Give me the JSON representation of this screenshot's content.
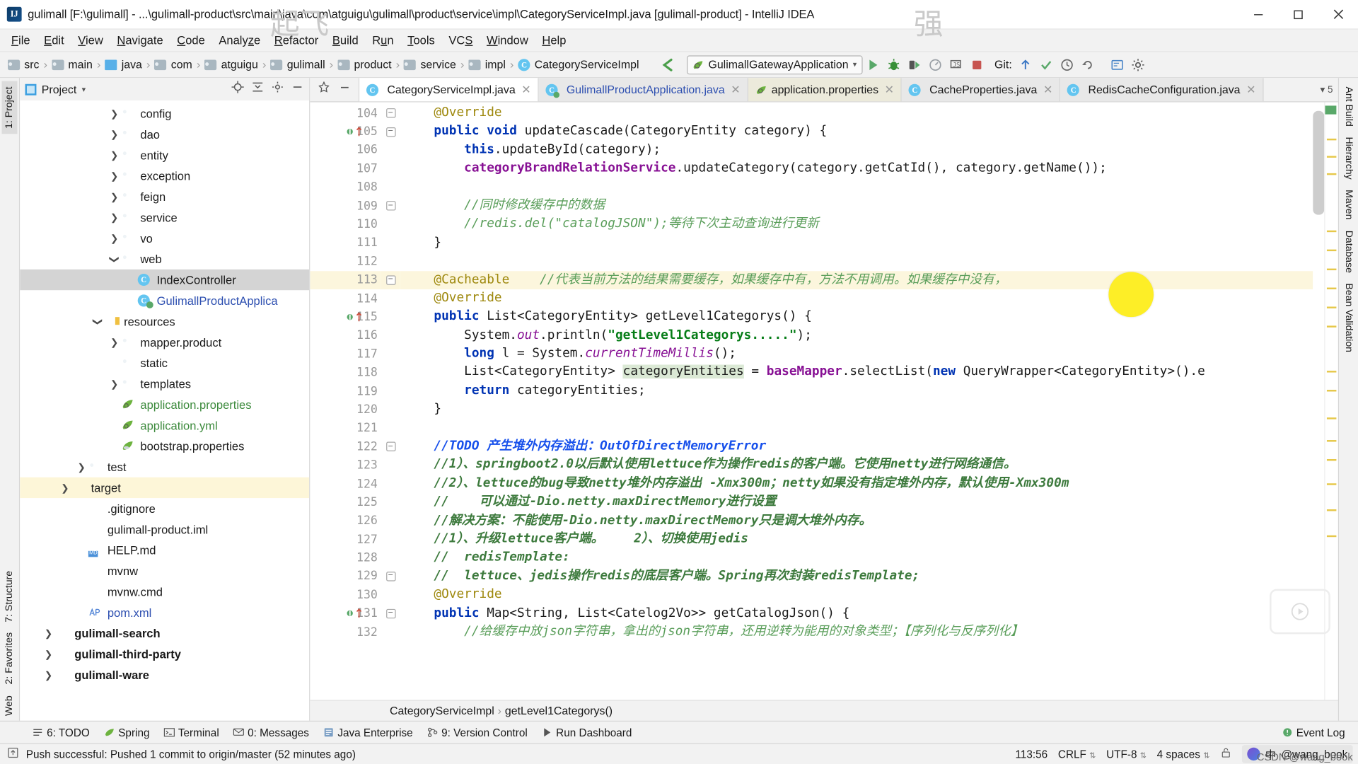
{
  "window": {
    "title": "gulimall [F:\\gulimall] - ...\\gulimall-product\\src\\main\\java\\com\\atguigu\\gulimall\\product\\service\\impl\\CategoryServiceImpl.java [gulimall-product] - IntelliJ IDEA",
    "app_icon": "IJ",
    "minimize": "—",
    "maximize": "❐",
    "close": "✕"
  },
  "menubar": {
    "items": [
      {
        "label": "File",
        "mnemonic": "F"
      },
      {
        "label": "Edit",
        "mnemonic": "E"
      },
      {
        "label": "View",
        "mnemonic": "V"
      },
      {
        "label": "Navigate",
        "mnemonic": "N"
      },
      {
        "label": "Code",
        "mnemonic": "C"
      },
      {
        "label": "Analyze",
        "mnemonic": "z"
      },
      {
        "label": "Refactor",
        "mnemonic": "R"
      },
      {
        "label": "Build",
        "mnemonic": "B"
      },
      {
        "label": "Run",
        "mnemonic": "u"
      },
      {
        "label": "Tools",
        "mnemonic": "T"
      },
      {
        "label": "VCS",
        "mnemonic": "S"
      },
      {
        "label": "Window",
        "mnemonic": "W"
      },
      {
        "label": "Help",
        "mnemonic": "H"
      }
    ]
  },
  "navbar": {
    "breadcrumbs": [
      {
        "label": "src",
        "icon": "folder-icon"
      },
      {
        "label": "main",
        "icon": "folder-icon"
      },
      {
        "label": "java",
        "icon": "source-folder-icon"
      },
      {
        "label": "com",
        "icon": "package-icon"
      },
      {
        "label": "atguigu",
        "icon": "package-icon"
      },
      {
        "label": "gulimall",
        "icon": "package-icon"
      },
      {
        "label": "product",
        "icon": "package-icon"
      },
      {
        "label": "service",
        "icon": "package-icon"
      },
      {
        "label": "impl",
        "icon": "package-icon"
      },
      {
        "label": "CategoryServiceImpl",
        "icon": "java-class-icon"
      }
    ],
    "run_config": "GulimallGatewayApplication",
    "git_label": "Git:",
    "toolbar_icons": [
      "run-icon",
      "debug-icon",
      "run-with-coverage-icon",
      "profile-icon",
      "attach-debugger-icon",
      "stop-icon"
    ],
    "git_icons": [
      "update-project-icon",
      "commit-icon",
      "history-icon",
      "rollback-icon"
    ],
    "right_icons": [
      "search-everywhere-icon",
      "settings-icon"
    ]
  },
  "project_panel": {
    "title": "Project",
    "tools": [
      "locate-icon",
      "collapse-all-icon",
      "settings-icon",
      "hide-icon"
    ],
    "tree": [
      {
        "label": "config",
        "indent": 5,
        "arrow": "right",
        "icon": "folder-icon"
      },
      {
        "label": "dao",
        "indent": 5,
        "arrow": "right",
        "icon": "folder-icon"
      },
      {
        "label": "entity",
        "indent": 5,
        "arrow": "right",
        "icon": "folder-icon"
      },
      {
        "label": "exception",
        "indent": 5,
        "arrow": "right",
        "icon": "folder-icon"
      },
      {
        "label": "feign",
        "indent": 5,
        "arrow": "right",
        "icon": "folder-icon"
      },
      {
        "label": "service",
        "indent": 5,
        "arrow": "right",
        "icon": "folder-icon"
      },
      {
        "label": "vo",
        "indent": 5,
        "arrow": "right",
        "icon": "folder-icon"
      },
      {
        "label": "web",
        "indent": 5,
        "arrow": "down",
        "icon": "folder-icon"
      },
      {
        "label": "IndexController",
        "indent": 6,
        "arrow": "none",
        "icon": "java-class-icon",
        "state": "selected"
      },
      {
        "label": "GulimallProductApplica",
        "indent": 6,
        "arrow": "none",
        "icon": "java-runnable-class-icon",
        "color": "blue"
      },
      {
        "label": "resources",
        "indent": 4,
        "arrow": "down",
        "icon": "resources-folder-icon"
      },
      {
        "label": "mapper.product",
        "indent": 5,
        "arrow": "right",
        "icon": "folder-icon"
      },
      {
        "label": "static",
        "indent": 5,
        "arrow": "none",
        "icon": "folder-icon"
      },
      {
        "label": "templates",
        "indent": 5,
        "arrow": "right",
        "icon": "folder-icon"
      },
      {
        "label": "application.properties",
        "indent": 5,
        "arrow": "none",
        "icon": "spring-properties-icon",
        "color": "green"
      },
      {
        "label": "application.yml",
        "indent": 5,
        "arrow": "none",
        "icon": "spring-yml-icon",
        "color": "green"
      },
      {
        "label": "bootstrap.properties",
        "indent": 5,
        "arrow": "none",
        "icon": "spring-cloud-properties-icon"
      },
      {
        "label": "test",
        "indent": 3,
        "arrow": "right",
        "icon": "folder-icon"
      },
      {
        "label": "target",
        "indent": 2,
        "arrow": "right",
        "icon": "target-folder-icon",
        "state": "highlighted"
      },
      {
        "label": ".gitignore",
        "indent": 3,
        "arrow": "none",
        "icon": "text-file-icon"
      },
      {
        "label": "gulimall-product.iml",
        "indent": 3,
        "arrow": "none",
        "icon": "iml-file-icon"
      },
      {
        "label": "HELP.md",
        "indent": 3,
        "arrow": "none",
        "icon": "markdown-file-icon"
      },
      {
        "label": "mvnw",
        "indent": 3,
        "arrow": "none",
        "icon": "text-file-icon"
      },
      {
        "label": "mvnw.cmd",
        "indent": 3,
        "arrow": "none",
        "icon": "text-file-icon"
      },
      {
        "label": "pom.xml",
        "indent": 3,
        "arrow": "none",
        "icon": "maven-pom-icon",
        "color": "blue"
      },
      {
        "label": "gulimall-search",
        "indent": 1,
        "arrow": "right",
        "icon": "module-folder-icon",
        "bold": true
      },
      {
        "label": "gulimall-third-party",
        "indent": 1,
        "arrow": "right",
        "icon": "module-folder-icon",
        "bold": true
      },
      {
        "label": "gulimall-ware",
        "indent": 1,
        "arrow": "right",
        "icon": "module-folder-icon",
        "bold": true
      }
    ]
  },
  "left_rail": [
    {
      "label": "1: Project",
      "state": "selected"
    },
    {
      "label": "7: Structure"
    },
    {
      "label": "2: Favorites"
    },
    {
      "label": "Web"
    }
  ],
  "right_rail": [
    {
      "label": "Ant Build"
    },
    {
      "label": "Hierarchy"
    },
    {
      "label": "Maven"
    },
    {
      "label": "Database"
    },
    {
      "label": "Bean Validation"
    }
  ],
  "editor": {
    "tabs": [
      {
        "label": "CategoryServiceImpl.java",
        "icon": "java-class-icon",
        "active": true
      },
      {
        "label": "GulimallProductApplication.java",
        "icon": "java-runnable-class-icon",
        "color": "blue"
      },
      {
        "label": "application.properties",
        "icon": "spring-properties-icon"
      },
      {
        "label": "CacheProperties.java",
        "icon": "java-class-icon"
      },
      {
        "label": "RedisCacheConfiguration.java",
        "icon": "java-class-icon"
      }
    ],
    "tab_overflow": "5",
    "first_line": 104,
    "highlight_line": 113,
    "breadcrumb": [
      "CategoryServiceImpl",
      "getLevel1Categorys()"
    ],
    "lines": [
      {
        "n": 104,
        "fold": "minus",
        "html": "    <span class=\"ann\">@Override</span>"
      },
      {
        "n": 105,
        "fold": "minus",
        "mark": "override-impl",
        "html": "    <span class=\"kw\">public</span> <span class=\"kw\">void</span> updateCascade(CategoryEntity category) {"
      },
      {
        "n": 106,
        "html": "        <span class=\"kw\">this</span>.updateById(category);"
      },
      {
        "n": 107,
        "html": "        <span class=\"fld\">categoryBrandRelationService</span>.updateCategory(category.getCatId(), category.getName());"
      },
      {
        "n": 108,
        "html": ""
      },
      {
        "n": 109,
        "fold": "minus",
        "html": "        <span class=\"cmt-green\">//同时修改缓存中的数据</span>"
      },
      {
        "n": 110,
        "html": "        <span class=\"cmt-green\">//redis.del(\"catalogJSON\");等待下次主动查询进行更新</span>"
      },
      {
        "n": 111,
        "html": "    }"
      },
      {
        "n": 112,
        "html": ""
      },
      {
        "n": 113,
        "fold": "minus",
        "bulb": true,
        "highlight": true,
        "html": "    <span class=\"ann\">@Cacheable</span>    <span class=\"cmt-green\">//代表当前方法的结果需要缓存，如果缓存中有，方法不用调用。如果缓存中没有，</span>"
      },
      {
        "n": 114,
        "html": "    <span class=\"ann\">@Override</span>"
      },
      {
        "n": 115,
        "mark": "override-impl",
        "html": "    <span class=\"kw\">public</span> List&lt;CategoryEntity&gt; getLevel1Categorys() {"
      },
      {
        "n": 116,
        "html": "        System.<span class=\"sfld\">out</span>.println(<span class=\"str\">\"getLevel1Categorys.....\"</span>);"
      },
      {
        "n": 117,
        "html": "        <span class=\"kw\">long</span> l = System.<span class=\"sfld\">currentTimeMillis</span>();"
      },
      {
        "n": 118,
        "html": "        List&lt;CategoryEntity&gt; <span class=\"hlbg\">categoryEntities</span> = <span class=\"fld\">baseMapper</span>.selectList(<span class=\"kw\">new</span> QueryWrapper&lt;CategoryEntity&gt;().e"
      },
      {
        "n": 119,
        "html": "        <span class=\"kw\">return</span> categoryEntities;"
      },
      {
        "n": 120,
        "html": "    }"
      },
      {
        "n": 121,
        "html": ""
      },
      {
        "n": 122,
        "fold": "minus",
        "html": "    <span class=\"todo\">//TODO 产生堆外内存溢出：OutOfDirectMemoryError</span>"
      },
      {
        "n": 123,
        "html": "    <span class=\"cmt-bold\">//1）、springboot2.0以后默认使用lettuce作为操作redis的客户端。它使用netty进行网络通信。</span>"
      },
      {
        "n": 124,
        "html": "    <span class=\"cmt-bold\">//2）、lettuce的bug导致netty堆外内存溢出 -Xmx300m；netty如果没有指定堆外内存，默认使用-Xmx300m</span>"
      },
      {
        "n": 125,
        "html": "    <span class=\"cmt-bold\">//    可以通过-Dio.netty.maxDirectMemory进行设置</span>"
      },
      {
        "n": 126,
        "html": "    <span class=\"cmt-bold\">//解决方案：不能使用-Dio.netty.maxDirectMemory只是调大堆外内存。</span>"
      },
      {
        "n": 127,
        "html": "    <span class=\"cmt-bold\">//1）、升级lettuce客户端。    2）、切换使用jedis</span>"
      },
      {
        "n": 128,
        "html": "    <span class=\"cmt-bold\">//  redisTemplate:</span>"
      },
      {
        "n": 129,
        "fold": "minus",
        "html": "    <span class=\"cmt-bold\">//  lettuce、jedis操作redis的底层客户端。Spring再次封装redisTemplate;</span>"
      },
      {
        "n": 130,
        "html": "    <span class=\"ann\">@Override</span>"
      },
      {
        "n": 131,
        "fold": "minus",
        "mark": "override-impl",
        "html": "    <span class=\"kw\">public</span> Map&lt;String, List&lt;Catelog2Vo&gt;&gt; getCatalogJson() {"
      },
      {
        "n": 132,
        "html": "        <span class=\"cmt-green\">//给缓存中放json字符串，拿出的json字符串，还用逆转为能用的对象类型；【序列化与反序列化】</span>"
      }
    ]
  },
  "bottom_bar": {
    "items": [
      {
        "label": "6: TODO",
        "icon": "todo-icon"
      },
      {
        "label": "Spring",
        "icon": "spring-icon"
      },
      {
        "label": "Terminal",
        "icon": "terminal-icon"
      },
      {
        "label": "0: Messages",
        "icon": "messages-icon"
      },
      {
        "label": "Java Enterprise",
        "icon": "java-enterprise-icon"
      },
      {
        "label": "9: Version Control",
        "icon": "version-control-icon"
      },
      {
        "label": "Run Dashboard",
        "icon": "run-dashboard-icon"
      }
    ],
    "event_log": "Event Log",
    "event_log_icon": "event-log-icon"
  },
  "status_bar": {
    "message": "Push successful: Pushed 1 commit to origin/master (52 minutes ago)",
    "message_icon": "vcs-push-icon",
    "position": "113:56",
    "line_separator": "CRLF",
    "encoding": "UTF-8",
    "indent": "4 spaces",
    "ime_lang": "中",
    "ime_name": "@wang_book",
    "lock_icon": "unlocked-icon"
  },
  "watermark": "CSDN @wang_book",
  "overlays": {
    "ghost_1": "起飞",
    "ghost_2": "强"
  },
  "colors": {
    "accent_blue": "#2d4fb0",
    "highlight_yellow": "#fcf6dd",
    "selection_gray": "#d4d4d4",
    "cursor_yellow": "#fdee27",
    "green_run": "#59a869"
  }
}
